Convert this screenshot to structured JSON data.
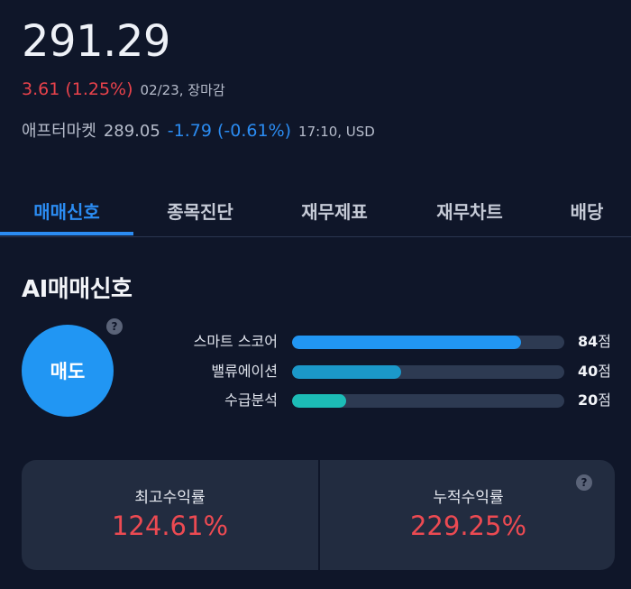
{
  "quote": {
    "price": "291.29",
    "change": "3.61 (1.25%)",
    "date_status": "02/23, 장마감",
    "after_market_label": "애프터마켓",
    "after_market_price": "289.05",
    "after_market_change": "-1.79 (-0.61%)",
    "after_market_time": "17:10, USD"
  },
  "tabs": [
    {
      "label": "매매신호",
      "active": true
    },
    {
      "label": "종목진단",
      "active": false
    },
    {
      "label": "재무제표",
      "active": false
    },
    {
      "label": "재무차트",
      "active": false
    },
    {
      "label": "배당",
      "active": false
    }
  ],
  "ai_signal": {
    "title": "AI매매신호",
    "signal": "매도",
    "help_icon": "question-circle-icon",
    "scores": [
      {
        "label": "스마트 스코어",
        "value": "84",
        "unit": "점",
        "fill": 0.84,
        "color": "#2196f3"
      },
      {
        "label": "밸류에이션",
        "value": "40",
        "unit": "점",
        "fill": 0.4,
        "color": "#1b98c9"
      },
      {
        "label": "수급분석",
        "value": "20",
        "unit": "점",
        "fill": 0.2,
        "color": "#1cbcb6"
      }
    ]
  },
  "returns": {
    "max_return_label": "최고수익률",
    "max_return_value": "124.61%",
    "cumulative_return_label": "누적수익률",
    "cumulative_return_value": "229.25%"
  },
  "colors": {
    "background": "#0f1629",
    "accent_blue": "#2b8cf2",
    "up_red": "#e8424b",
    "card": "#222c40"
  }
}
